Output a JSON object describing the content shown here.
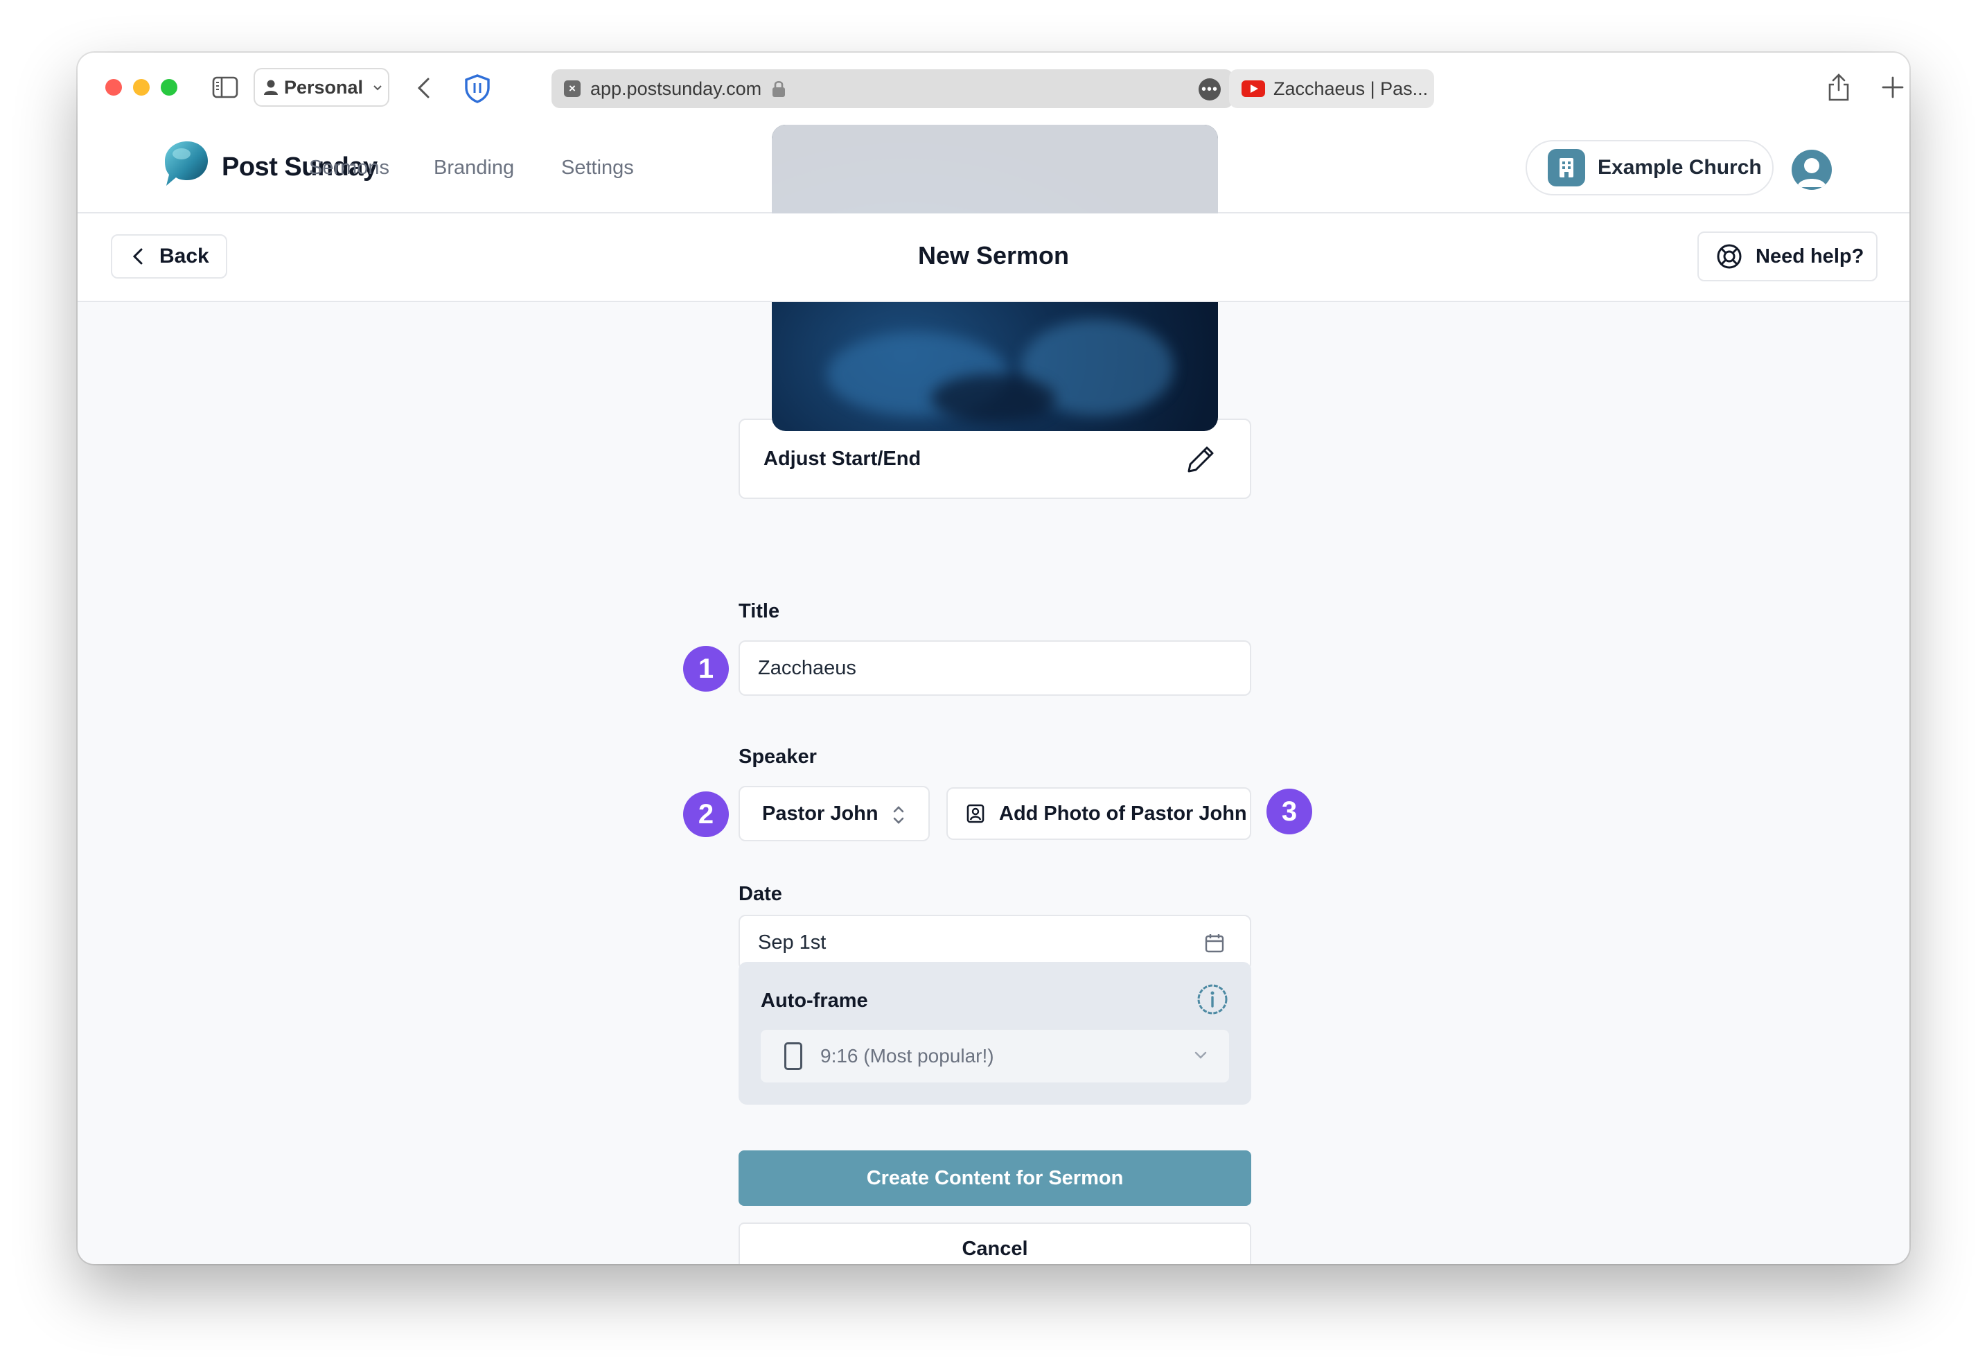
{
  "browser": {
    "profile_label": "Personal",
    "address": "app.postsunday.com",
    "other_tab_title": "Zacchaeus | Pas..."
  },
  "app": {
    "brand": "Post Sunday",
    "nav": [
      "Sermons",
      "Branding",
      "Settings"
    ],
    "church_label": "Example Church",
    "accent_color": "#5f9bb0",
    "badge_color": "#7c4dea"
  },
  "subheader": {
    "back_label": "Back",
    "title": "New Sermon",
    "help_label": "Need help?"
  },
  "form": {
    "adjust_label": "Adjust Start/End",
    "title_label": "Title",
    "title_value": "Zacchaeus",
    "speaker_label": "Speaker",
    "speaker_value": "Pastor John",
    "add_photo_label": "Add Photo of Pastor John",
    "date_label": "Date",
    "date_value": "Sep 1st",
    "autoframe_label": "Auto-frame",
    "autoframe_value": "9:16 (Most popular!)",
    "create_label": "Create Content for Sermon",
    "cancel_label": "Cancel"
  },
  "badges": [
    "1",
    "2",
    "3"
  ]
}
